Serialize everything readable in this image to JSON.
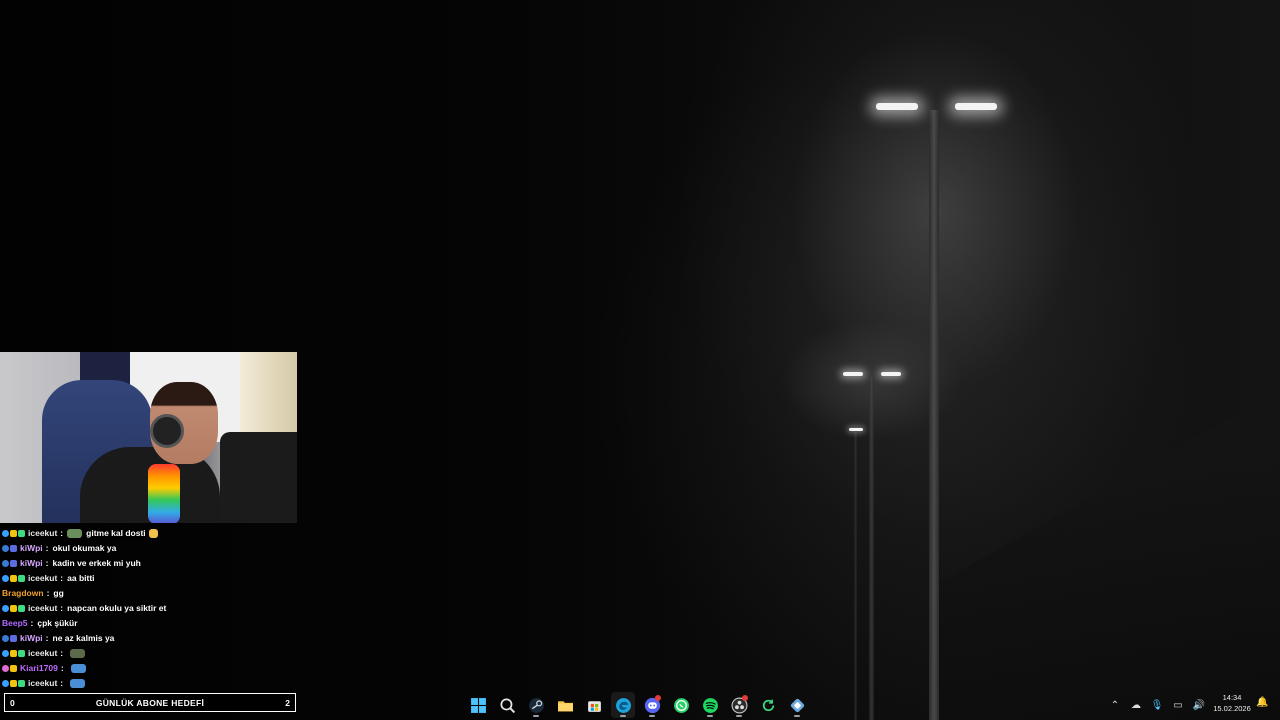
{
  "chat": {
    "messages": [
      {
        "user": "iceekut",
        "user_color": "#e8e8e8",
        "badges": [
          "#3aa0ff",
          "#f1c40f",
          "#3ddc84"
        ],
        "text": "gitme kal dosti",
        "emotes": [
          "#6a8f5a",
          "#f2c14e"
        ]
      },
      {
        "user": "kiWpi",
        "user_color": "#d7a8ff",
        "badges": [
          "#3a7bd5",
          "#5b6ee1"
        ],
        "text": "okul okumak ya",
        "emotes": []
      },
      {
        "user": "kiWpi",
        "user_color": "#d7a8ff",
        "badges": [
          "#3a7bd5",
          "#5b6ee1"
        ],
        "text": "kadin ve erkek mi yuh",
        "emotes": []
      },
      {
        "user": "iceekut",
        "user_color": "#e8e8e8",
        "badges": [
          "#3aa0ff",
          "#f1c40f",
          "#3ddc84"
        ],
        "text": "aa bitti",
        "emotes": []
      },
      {
        "user": "Bragdown",
        "user_color": "#f0a030",
        "badges": [],
        "text": "gg",
        "emotes": []
      },
      {
        "user": "iceekut",
        "user_color": "#e8e8e8",
        "badges": [
          "#3aa0ff",
          "#f1c40f",
          "#3ddc84"
        ],
        "text": "napcan okulu ya siktir et",
        "emotes": []
      },
      {
        "user": "Beep5",
        "user_color": "#b36bff",
        "badges": [],
        "text": "çpk şükür",
        "emotes": []
      },
      {
        "user": "kiWpi",
        "user_color": "#d7a8ff",
        "badges": [
          "#3a7bd5",
          "#5b6ee1"
        ],
        "text": "ne az kalmis ya",
        "emotes": []
      },
      {
        "user": "iceekut",
        "user_color": "#e8e8e8",
        "badges": [
          "#3aa0ff",
          "#f1c40f",
          "#3ddc84"
        ],
        "text": "",
        "emotes": [
          "#5a6a4a"
        ]
      },
      {
        "user": "Kiari1709",
        "user_color": "#c06bff",
        "badges": [
          "#e06bd0",
          "#f1c40f"
        ],
        "text": "",
        "emotes": [
          "#4a8fd5"
        ]
      },
      {
        "user": "iceekut",
        "user_color": "#e8e8e8",
        "badges": [
          "#3aa0ff",
          "#f1c40f",
          "#3ddc84"
        ],
        "text": "",
        "emotes": [
          "#4a8fd5"
        ]
      }
    ]
  },
  "goal": {
    "current": "0",
    "title": "GÜNLÜK ABONE HEDEFİ",
    "target": "2"
  },
  "taskbar": {
    "apps": [
      {
        "name": "start",
        "icon": "windows-icon",
        "running": false,
        "active": false
      },
      {
        "name": "search",
        "icon": "search-icon",
        "running": false,
        "active": false
      },
      {
        "name": "steam",
        "icon": "steam-icon",
        "running": true,
        "active": false
      },
      {
        "name": "file-explorer",
        "icon": "folder-icon",
        "running": false,
        "active": false
      },
      {
        "name": "microsoft-store",
        "icon": "store-icon",
        "running": false,
        "active": false
      },
      {
        "name": "edge",
        "icon": "edge-icon",
        "running": true,
        "active": true
      },
      {
        "name": "discord",
        "icon": "discord-icon",
        "running": true,
        "active": false,
        "notify": true
      },
      {
        "name": "whatsapp",
        "icon": "whatsapp-icon",
        "running": false,
        "active": false
      },
      {
        "name": "spotify",
        "icon": "spotify-icon",
        "running": true,
        "active": false
      },
      {
        "name": "obs",
        "icon": "obs-icon",
        "running": true,
        "active": false,
        "notify": true
      },
      {
        "name": "refresh-app",
        "icon": "circle-arrow-icon",
        "running": false,
        "active": false
      },
      {
        "name": "network-app",
        "icon": "network-icon",
        "running": true,
        "active": false
      }
    ],
    "tray": [
      "chevron-up-icon",
      "cloud-icon",
      "microphone-icon",
      "monitor-icon",
      "volume-icon"
    ],
    "time": "14:34",
    "date": "15.02.2026"
  },
  "colors": {
    "accent_edge": "#1ea4dd",
    "spotify": "#1ed760",
    "whatsapp": "#25d366",
    "discord": "#5865f2",
    "windows": "#4cc2ff"
  }
}
